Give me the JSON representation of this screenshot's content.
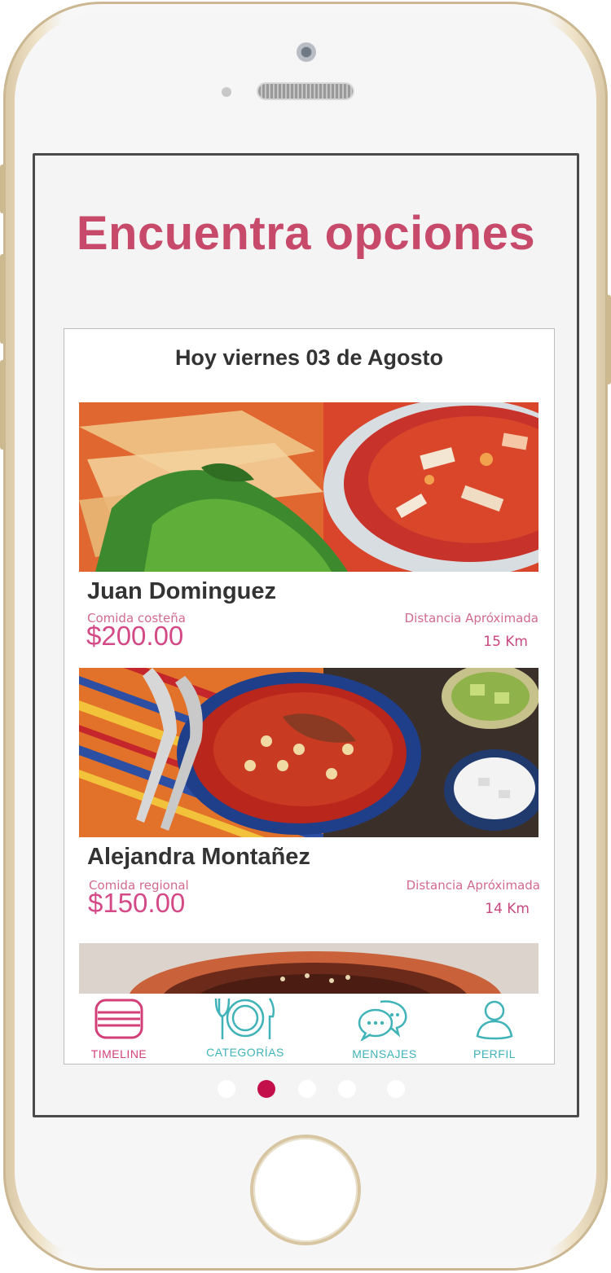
{
  "page": {
    "title": "Encuentra opciones"
  },
  "app": {
    "date_header": "Hoy viernes 03 de Agosto",
    "cards": [
      {
        "name": "Juan Dominguez",
        "category": "Comida costeña",
        "price": "$200.00",
        "distance_label": "Distancia Apróximada",
        "distance_value": "15 Km",
        "photo": "tortilla-soup-photo"
      },
      {
        "name": "Alejandra Montañez",
        "category": "Comida regional",
        "price": "$150.00",
        "distance_label": "Distancia Apróximada",
        "distance_value": "14 Km",
        "photo": "pozole-photo"
      },
      {
        "photo": "mole-dish-photo"
      }
    ],
    "nav": [
      {
        "label": "TIMELINE",
        "icon": "timeline-icon",
        "active": true
      },
      {
        "label": "CATEGORÍAS",
        "icon": "plate-cutlery-icon",
        "active": false
      },
      {
        "label": "MENSAJES",
        "icon": "chat-bubbles-icon",
        "active": false
      },
      {
        "label": "PERFIL",
        "icon": "user-icon",
        "active": false
      }
    ]
  },
  "pager": {
    "count": 5,
    "active_index": 1
  },
  "colors": {
    "title": "#c84a6a",
    "price": "#d34a87",
    "nav_active": "#d33f77",
    "nav_inactive": "#3fb3b8",
    "dot_active": "#c4104a"
  }
}
